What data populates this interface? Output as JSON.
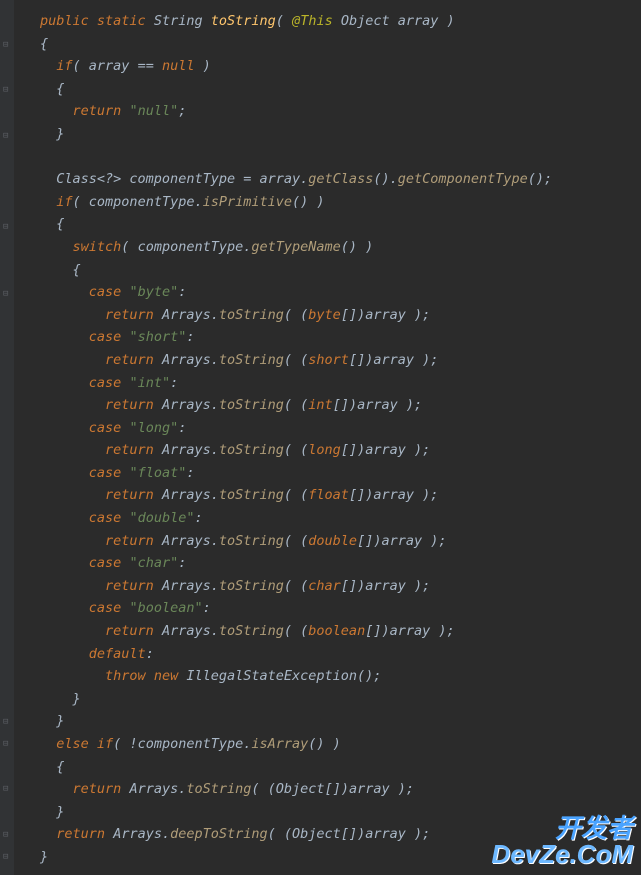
{
  "code": {
    "t0": "public",
    "t1": "static",
    "t2": "String",
    "t3": "toString",
    "t4": "@This",
    "t5": "Object",
    "t6": "array",
    "l3_0": "if",
    "l3_1": "array",
    "l3_2": "null",
    "l5_0": "return",
    "l5_1": "\"null\"",
    "l8_0": "Class",
    "l8_1": "componentType",
    "l8_2": "array",
    "l8_3": "getClass",
    "l8_4": "getComponentType",
    "l9_0": "if",
    "l9_1": "componentType",
    "l9_2": "isPrimitive",
    "l11_0": "switch",
    "l11_1": "componentType",
    "l11_2": "getTypeName",
    "c_byte": "case",
    "s_byte": "\"byte\"",
    "r_ret": "return",
    "r_arr": "Arrays",
    "r_ts": "toString",
    "cast_byte": "byte",
    "r_a": "array",
    "c_short": "case",
    "s_short": "\"short\"",
    "cast_short": "short",
    "c_int": "case",
    "s_int": "\"int\"",
    "cast_int": "int",
    "c_long": "case",
    "s_long": "\"long\"",
    "cast_long": "long",
    "c_float": "case",
    "s_float": "\"float\"",
    "cast_float": "float",
    "c_double": "case",
    "s_double": "\"double\"",
    "cast_double": "double",
    "c_char": "case",
    "s_char": "\"char\"",
    "cast_char": "char",
    "c_boolean": "case",
    "s_boolean": "\"boolean\"",
    "cast_boolean": "boolean",
    "default": "default",
    "throw": "throw",
    "new": "new",
    "ise": "IllegalStateException",
    "elseif": "else if",
    "not": "!",
    "isArray": "isArray",
    "cast_obj": "Object",
    "deep": "deepToString"
  },
  "watermark": {
    "line1": "开发者",
    "line2": "DevZe.CoM"
  }
}
